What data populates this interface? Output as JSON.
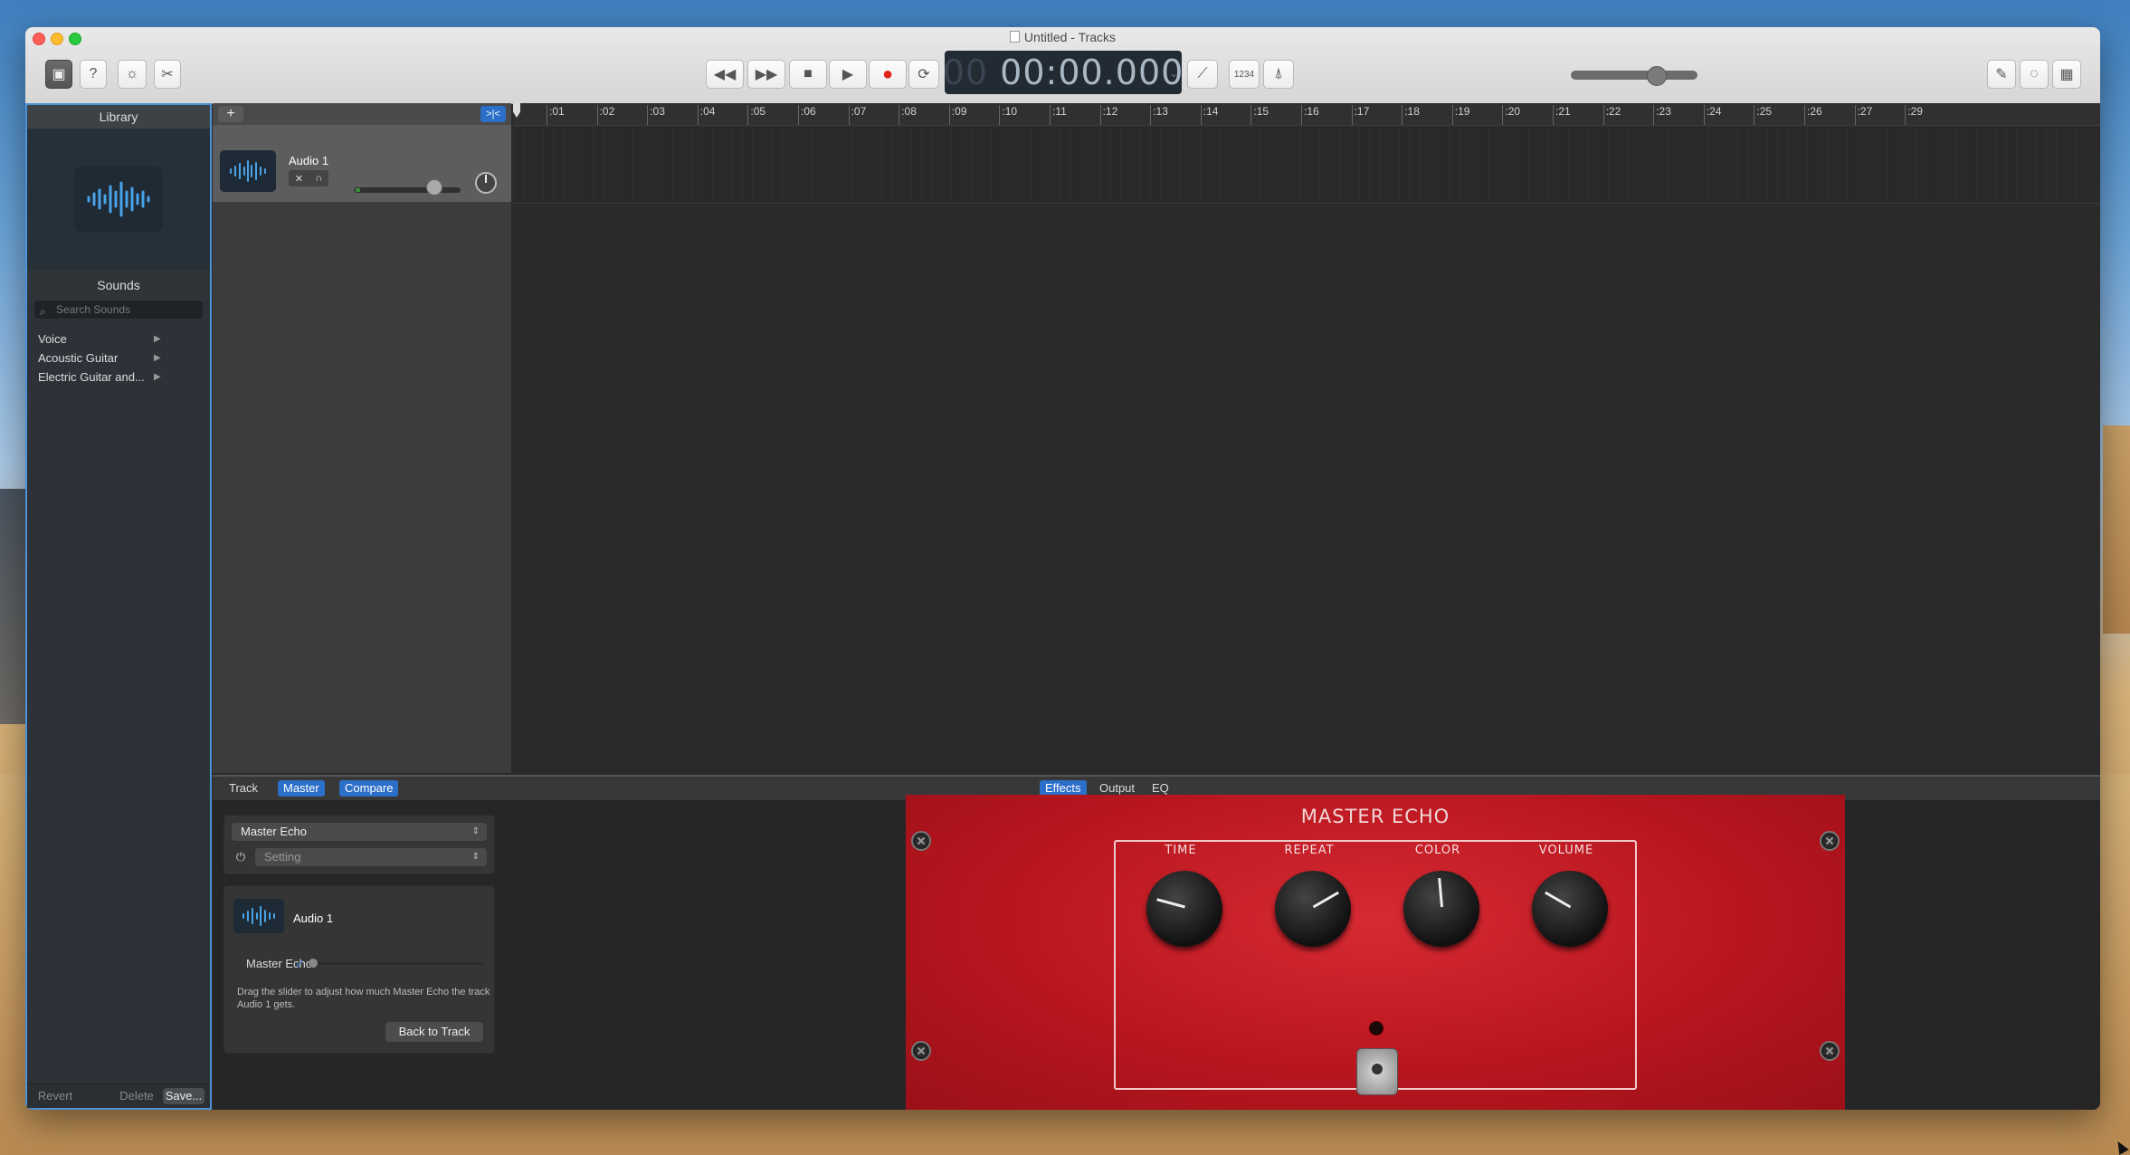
{
  "window": {
    "title": "Untitled - Tracks",
    "lcd_time": "00:00.000",
    "lcd_prefix": "00",
    "count_in": "1234"
  },
  "library": {
    "header": "Library",
    "sounds_header": "Sounds",
    "search_placeholder": "Search Sounds",
    "items": [
      {
        "label": "Voice"
      },
      {
        "label": "Acoustic Guitar"
      },
      {
        "label": "Electric Guitar and..."
      }
    ],
    "revert": "Revert",
    "delete": "Delete",
    "save": "Save..."
  },
  "tracks": {
    "add": "+",
    "filter": ">|<",
    "track1": {
      "name": "Audio 1"
    }
  },
  "ruler": {
    "ticks": [
      ":01",
      ":02",
      ":03",
      ":04",
      ":05",
      ":06",
      ":07",
      ":08",
      ":09",
      ":10",
      ":11",
      ":12",
      ":13",
      ":14",
      ":15",
      ":16",
      ":17",
      ":18",
      ":19",
      ":20",
      ":21",
      ":22",
      ":23",
      ":24",
      ":25",
      ":26",
      ":27",
      ":29"
    ]
  },
  "bottom": {
    "tabs_left": [
      "Track",
      "Master",
      "Compare"
    ],
    "tabs_right": [
      "Effects",
      "Output",
      "EQ"
    ],
    "plugin_name": "Master Echo",
    "setting": "Setting",
    "send_track": "Audio 1",
    "send_label": "Master Echo:",
    "send_check": "✓",
    "help_text": "Drag the slider to adjust how much Master Echo the track Audio 1 gets.",
    "back_button": "Back to Track"
  },
  "pedal": {
    "title": "MASTER ECHO",
    "knobs": [
      "TIME",
      "REPEAT",
      "COLOR",
      "VOLUME"
    ]
  },
  "colors": {
    "accent": "#2c6fc9",
    "pedal_red": "#c51b24",
    "record": "#e2231a"
  }
}
